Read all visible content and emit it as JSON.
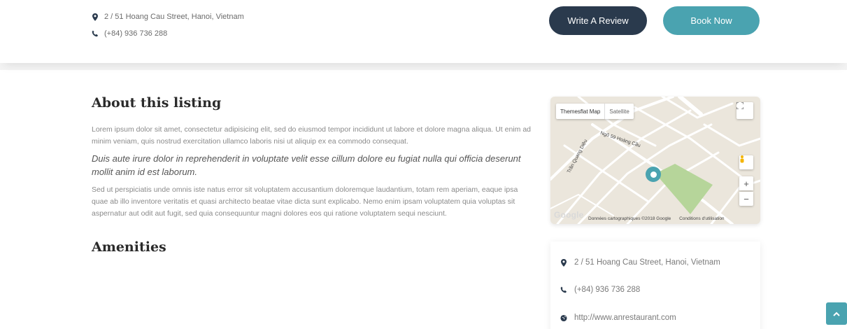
{
  "header": {
    "address": "2 / 51 Hoang Cau Street, Hanoi, Vietnam",
    "phone": "(+84) 936 736 288",
    "write_review_label": "Write A Review",
    "book_now_label": "Book Now"
  },
  "about": {
    "title": "About this listing",
    "paragraph1": "Lorem ipsum dolor sit amet, consectetur adipisicing elit, sed do eiusmod tempor incididunt ut labore et dolore magna aliqua. Ut enim ad minim veniam, quis nostrud exercitation ullamco laboris nisi ut aliquip ex ea commodo consequat.",
    "quote": "Duis aute irure dolor in reprehenderit in voluptate velit esse cillum dolore eu fugiat nulla qui officia deserunt mollit anim id est laborum.",
    "paragraph2": "Sed ut perspiciatis unde omnis iste natus error sit voluptatem accusantium doloremque laudantium, totam rem aperiam, eaque ipsa quae ab illo inventore veritatis et quasi architecto beatae vitae dicta sunt explicabo. Nemo enim ipsam voluptatem quia voluptas sit aspernatur aut odit aut fugit, sed quia consequuntur magni dolores eos qui ratione voluptatem sequi nesciunt."
  },
  "amenities": {
    "title": "Amenities"
  },
  "map": {
    "tab_map": "Themesflat Map",
    "tab_satellite": "Satellite",
    "street_label_1": "Ngõ 59 Hoàng Cầu",
    "street_label_2": "Trần Quang Diệu",
    "google_logo": "Google",
    "attribution": "Données cartographiques ©2018 Google",
    "terms": "Conditions d'utilisation",
    "zoom_in": "+",
    "zoom_out": "−"
  },
  "sidebar": {
    "address": "2 / 51 Hoang Cau Street, Hanoi, Vietnam",
    "phone": "(+84) 936 736 288",
    "website": "http://www.anrestaurant.com"
  },
  "colors": {
    "accent": "#4aa3b0",
    "dark_button": "#2a3a4d",
    "park": "#b6d59a"
  }
}
